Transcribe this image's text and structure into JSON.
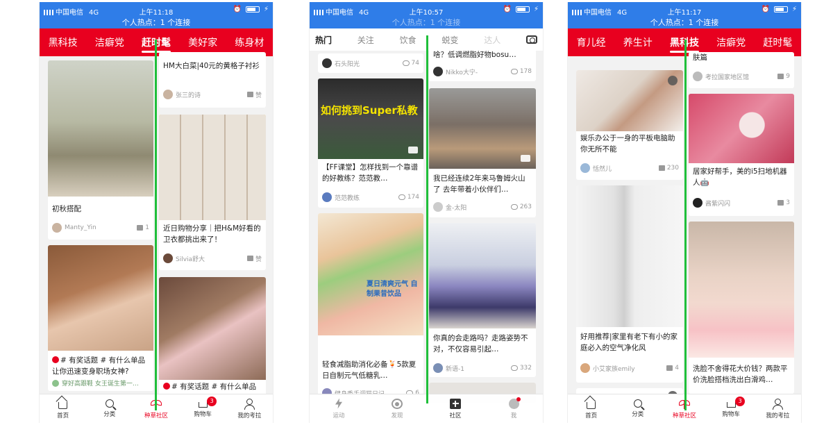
{
  "screens": [
    {
      "status": {
        "carrier": "中国电信",
        "network": "4G",
        "time": "上午11:18",
        "hot_label": "个人热点：1 个连接"
      },
      "tabs": [
        "黑科技",
        "洁癖党",
        "赶时髦",
        "美好家",
        "练身材"
      ],
      "active_tab": "赶时髦",
      "cards": [
        {
          "caption": "初秋搭配",
          "user": "Manty_Yin",
          "count": "1"
        },
        {
          "caption": "# 有奖话题 # 有什么单品让你迅速变身职场女神?",
          "user": "穿好高跟鞋 女王诞生第一…",
          "count": ""
        },
        {
          "caption": "HM大白菜|40元的黄格子衬衫",
          "user": "张三的诗",
          "count": "赞"
        },
        {
          "caption": "近日购物分享｜把H&M好看的卫衣都挑出来了！",
          "user": "Silvia舒大",
          "count": "赞"
        },
        {
          "caption": "# 有奖话题 # 有什么单品",
          "user": "",
          "count": ""
        }
      ],
      "nav": [
        {
          "label": "首页",
          "icon": "home-icon"
        },
        {
          "label": "分类",
          "icon": "search-icon"
        },
        {
          "label": "种草社区",
          "icon": "sprout-icon"
        },
        {
          "label": "购物车",
          "icon": "cart-icon",
          "badge": "3"
        },
        {
          "label": "我的考拉",
          "icon": "person-icon"
        }
      ]
    },
    {
      "status": {
        "carrier": "中国电信",
        "network": "4G",
        "time": "上午10:57",
        "hot_label": "个人热点：1 个连接"
      },
      "tabs": [
        "热门",
        "关注",
        "饮食",
        "蜕变",
        "达人"
      ],
      "active_tab": "热门",
      "cards": [
        {
          "caption": "",
          "user": "石头阳光",
          "count": "74"
        },
        {
          "caption": "【FF课堂】怎样找到一个靠谱的好教练？范范教…",
          "user": "范范教练",
          "count": "174",
          "overlay": "如何挑到Super私教 几个技能get✅"
        },
        {
          "caption": "轻食减脂助消化必备🍹5款夏日自制元气低糖乳…",
          "user": "健身委手调猫日记",
          "count": "6",
          "overlay": "夏日清爽元气 自制果昔饮品"
        },
        {
          "caption": "啥？低调燃脂好物bosu…",
          "user": "Nikko大宁-",
          "count": "178"
        },
        {
          "caption": "我已经连续2年来马鲁姆火山了 去年带着小伙伴们…",
          "user": "金-太阳",
          "count": "263"
        },
        {
          "caption": "你真的会走路吗？走路姿势不对，不仅容易引起…",
          "user": "新语-1",
          "count": "332"
        }
      ],
      "nav": [
        {
          "label": "运动",
          "icon": "bolt-icon"
        },
        {
          "label": "发现",
          "icon": "discover-icon"
        },
        {
          "label": "社区",
          "icon": "community-icon"
        },
        {
          "label": "我",
          "icon": "profile-icon"
        }
      ]
    },
    {
      "status": {
        "carrier": "中国电信",
        "network": "4G",
        "time": "上午11:17",
        "hot_label": "个人热点：1 个连接"
      },
      "tabs": [
        "育儿经",
        "养生计",
        "黑科技",
        "洁癖党",
        "赶时髦"
      ],
      "active_tab": "黑科技",
      "cards": [
        {
          "caption": "娱乐办公于一身的平板电脑助你无所不能",
          "user": "恬然儿",
          "count": "230"
        },
        {
          "caption": "好用推荐|家里有老下有小的家庭必入的空气净化风",
          "user": "小艾家族emily",
          "count": "4"
        },
        {
          "caption": "肤篇",
          "user": "考拉国家地区馆",
          "count": "9"
        },
        {
          "caption": "居家好帮手，美的i5扫地机器人🤖",
          "user": "酱紫闪闪",
          "count": "3"
        },
        {
          "caption": "洗脸不舍得花大价钱？两款平价洗脸搭档洗出白滑鸡…",
          "user": "",
          "count": ""
        }
      ],
      "nav": [
        {
          "label": "首页",
          "icon": "home-icon"
        },
        {
          "label": "分类",
          "icon": "search-icon"
        },
        {
          "label": "种草社区",
          "icon": "sprout-icon"
        },
        {
          "label": "购物车",
          "icon": "cart-icon",
          "badge": "3"
        },
        {
          "label": "我的考拉",
          "icon": "person-icon"
        }
      ]
    }
  ],
  "colors": {
    "status_blue": "#2f7de8",
    "kaola_red": "#e8001f",
    "guide_green": "#1fbf3a"
  }
}
